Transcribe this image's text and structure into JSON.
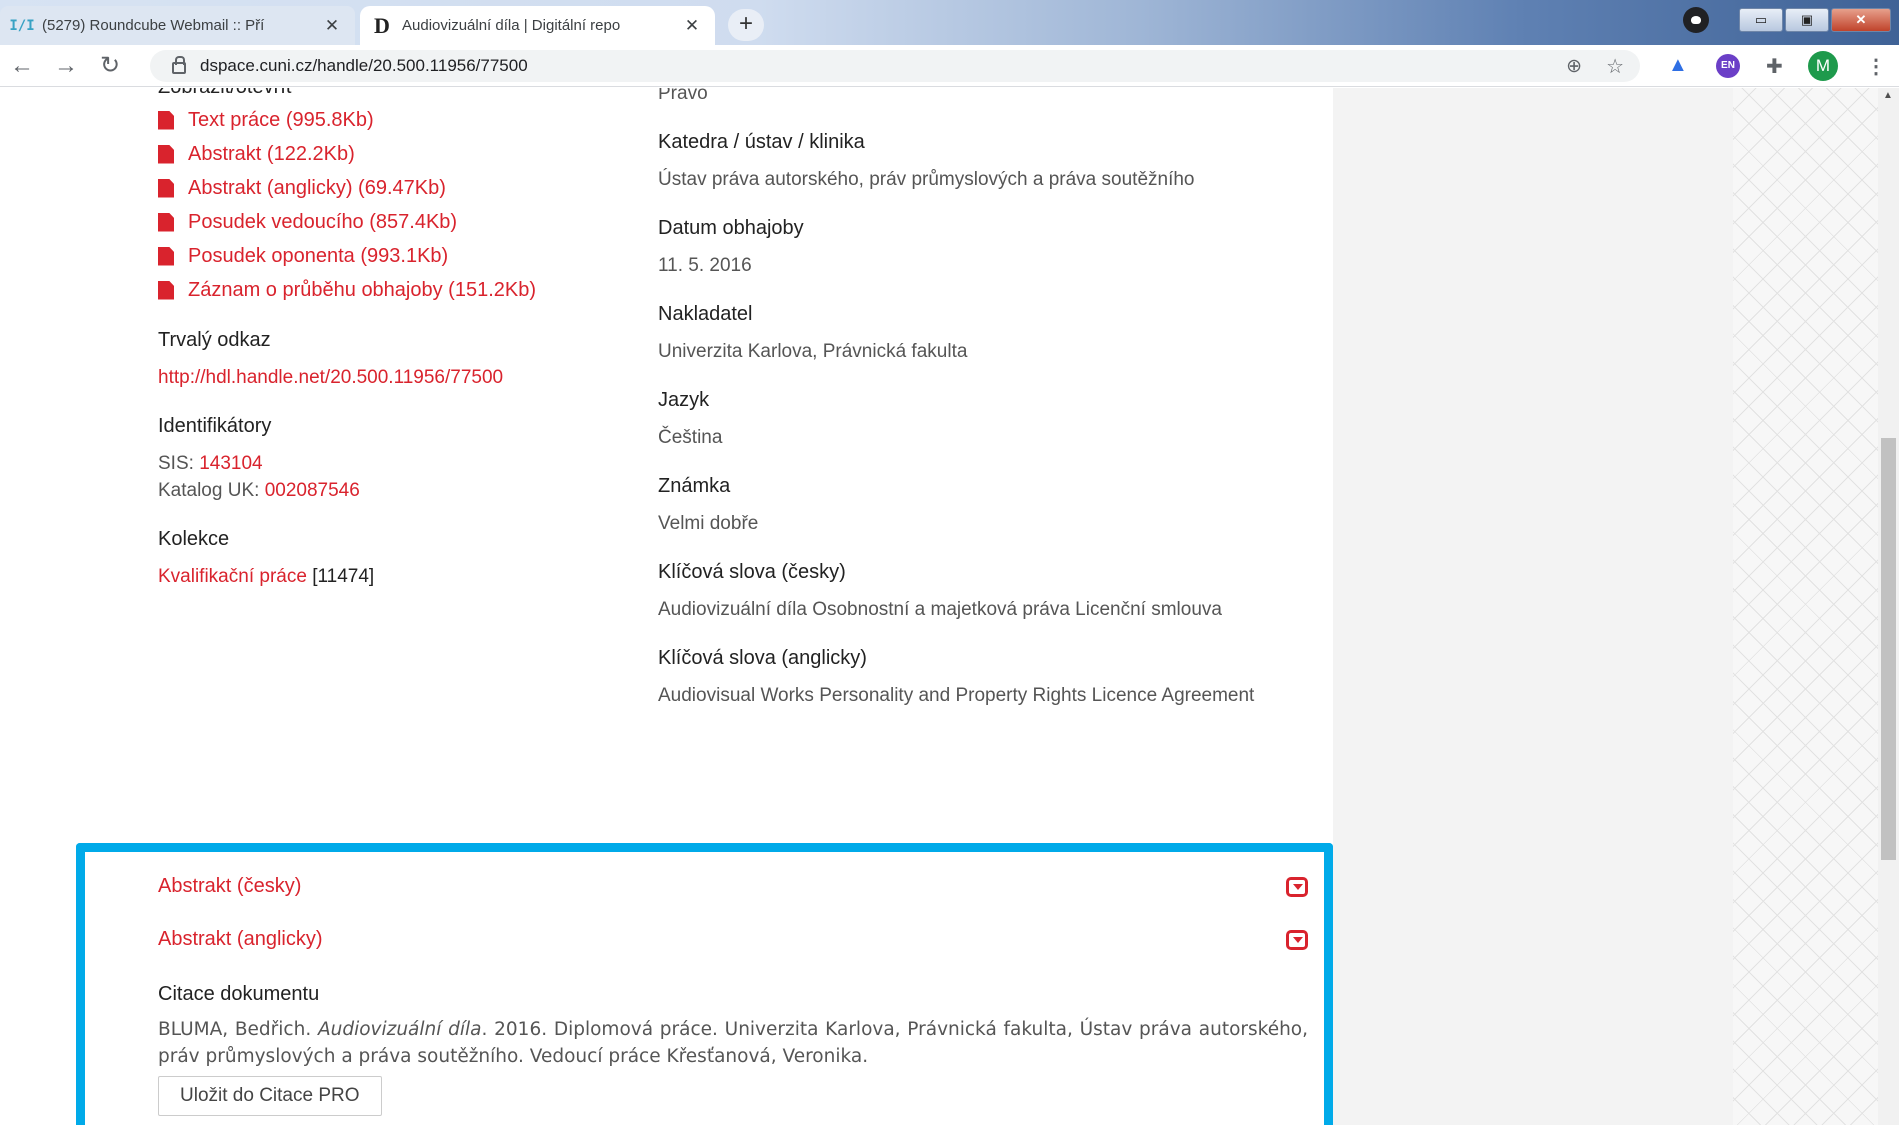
{
  "browser": {
    "tabs": [
      {
        "favicon": "roundcube-icon",
        "title": "(5279) Roundcube Webmail :: Pří"
      },
      {
        "favicon": "dspace-icon",
        "title": "Audiovizuální díla | Digitální repo"
      }
    ],
    "new_tab": "+",
    "url": "dspace.cuni.cz/handle/20.500.11956/77500",
    "window_controls": {
      "minimize": "▭",
      "maximize": "▣",
      "close": "✕"
    },
    "extensions": {
      "en_badge": "EN",
      "avatar_letter": "M"
    }
  },
  "left": {
    "files_heading": "Zobrazit/otevřít",
    "files": [
      {
        "label": "Text práce (995.8Kb)"
      },
      {
        "label": "Abstrakt (122.2Kb)"
      },
      {
        "label": "Abstrakt (anglicky) (69.47Kb)"
      },
      {
        "label": "Posudek vedoucího (857.4Kb)"
      },
      {
        "label": "Posudek oponenta (993.1Kb)"
      },
      {
        "label": "Záznam o průběhu obhajoby (151.2Kb)"
      }
    ],
    "permalink_heading": "Trvalý odkaz",
    "permalink": "http://hdl.handle.net/20.500.11956/77500",
    "identifiers_heading": "Identifikátory",
    "sis_label": "SIS:",
    "sis_value": "143104",
    "catalog_label": "Katalog UK:",
    "catalog_value": "002087546",
    "collection_heading": "Kolekce",
    "collection_link": "Kvalifikační práce",
    "collection_count": "[11474]"
  },
  "right": {
    "faculty_value": "Právo",
    "department_heading": "Katedra / ústav / klinika",
    "department_value": "Ústav práva autorského, práv průmyslových a práva soutěžního",
    "defense_date_heading": "Datum obhajoby",
    "defense_date_value": "11. 5. 2016",
    "publisher_heading": "Nakladatel",
    "publisher_value": "Univerzita Karlova, Právnická fakulta",
    "language_heading": "Jazyk",
    "language_value": "Čeština",
    "grade_heading": "Známka",
    "grade_value": "Velmi dobře",
    "keywords_cz_heading": "Klíčová slova (česky)",
    "keywords_cz_value": "Audiovizuální díla Osobnostní a majetková práva Licenční smlouva",
    "keywords_en_heading": "Klíčová slova (anglicky)",
    "keywords_en_value": "Audiovisual Works Personality and Property Rights Licence Agreement"
  },
  "bottom": {
    "abstract_cz": "Abstrakt (česky)",
    "abstract_en": "Abstrakt (anglicky)",
    "citation_heading": "Citace dokumentu",
    "citation_part1": "BLUMA, Bedřich. ",
    "citation_title": "Audiovizuální díla",
    "citation_part2": ". 2016. Diplomová práce. Univerzita Karlova, Právnická fakulta, Ústav práva autorského, práv průmyslových a práva soutěžního. Vedoucí práce Křesťanová, Veronika.",
    "citation_button": "Uložit do Citace PRO"
  },
  "colors": {
    "accent_red": "#d9232d",
    "highlight_blue": "#00aae9"
  }
}
